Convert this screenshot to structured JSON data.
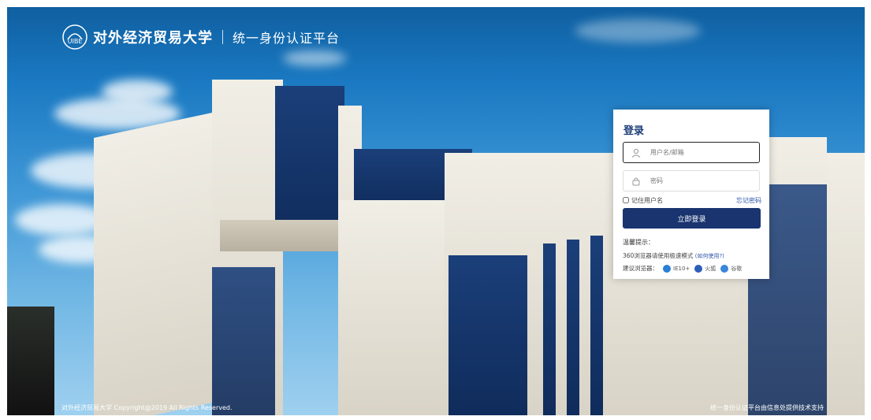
{
  "brand": {
    "university_name": "对外经济贸易大学",
    "platform_name": "统一身份认证平台"
  },
  "login": {
    "title": "登录",
    "username_placeholder": "用户名/邮箱",
    "password_placeholder": "密码",
    "remember_label": "记住用户名",
    "forgot_label": "忘记密码",
    "submit_label": "立即登录"
  },
  "tips": {
    "title": "温馨提示：",
    "text_360": "360浏览器请使用极速模式",
    "how_to_label": "(如何使用?)",
    "recommend_label": "建议浏览器：",
    "browsers": [
      {
        "label": "IE10+",
        "icon": "ie-icon",
        "color": "#2a7fd4"
      },
      {
        "label": "火狐",
        "icon": "firefox-icon",
        "color": "#2b5fb8"
      },
      {
        "label": "谷歌",
        "icon": "chrome-icon",
        "color": "#3a86d9"
      }
    ]
  },
  "footer": {
    "copyright": "对外经济贸易大学 Copyright@2019 All Rights Reserved.",
    "support": "统一身份认证平台由信息处提供技术支持"
  }
}
